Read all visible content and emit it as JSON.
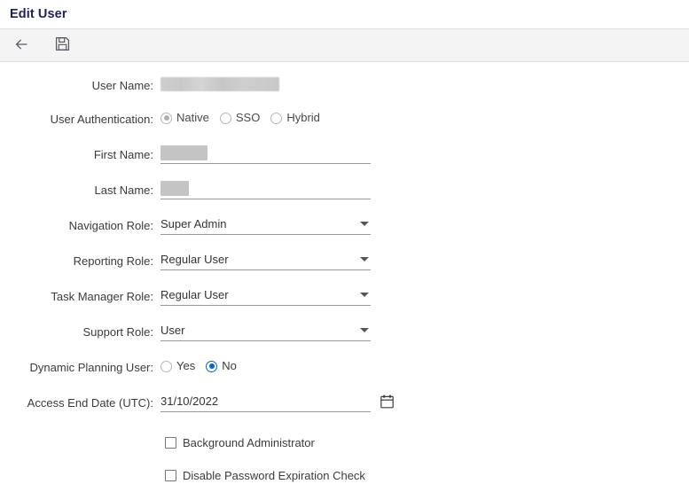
{
  "window": {
    "title": "Edit User"
  },
  "toolbar": {
    "back_icon": "back-arrow-icon",
    "back_label": "Back",
    "save_icon": "save-floppy-icon",
    "save_label": "Save"
  },
  "form": {
    "rows": {
      "user_name": {
        "label": "User Name:",
        "value": "",
        "redacted": true
      },
      "user_authentication": {
        "label": "User Authentication:",
        "options": [
          "Native",
          "SSO",
          "Hybrid"
        ],
        "selected": "Native"
      },
      "first_name": {
        "label": "First Name:",
        "value": "",
        "redacted": true
      },
      "last_name": {
        "label": "Last Name:",
        "value": "",
        "redacted": true
      },
      "navigation_role": {
        "label": "Navigation Role:",
        "value": "Super Admin"
      },
      "reporting_role": {
        "label": "Reporting Role:",
        "value": "Regular User"
      },
      "task_manager_role": {
        "label": "Task Manager Role:",
        "value": "Regular User"
      },
      "support_role": {
        "label": "Support Role:",
        "value": "User"
      },
      "dynamic_planning_user": {
        "label": "Dynamic Planning User:",
        "options": [
          "Yes",
          "No"
        ],
        "selected": "No"
      },
      "access_end_date": {
        "label": "Access End Date (UTC):",
        "value": "31/10/2022",
        "calendar_icon": "calendar-icon"
      }
    },
    "checkboxes": [
      {
        "label": "Background Administrator",
        "checked": false
      },
      {
        "label": "Disable Password Expiration Check",
        "checked": false
      }
    ]
  },
  "colors": {
    "title": "#1d2352",
    "accent_blue": "#0a62c9",
    "toolbar_bg": "#f4f4f4",
    "text": "#333333",
    "underline": "#9a9a9a",
    "redaction": "#c4c4c4"
  }
}
